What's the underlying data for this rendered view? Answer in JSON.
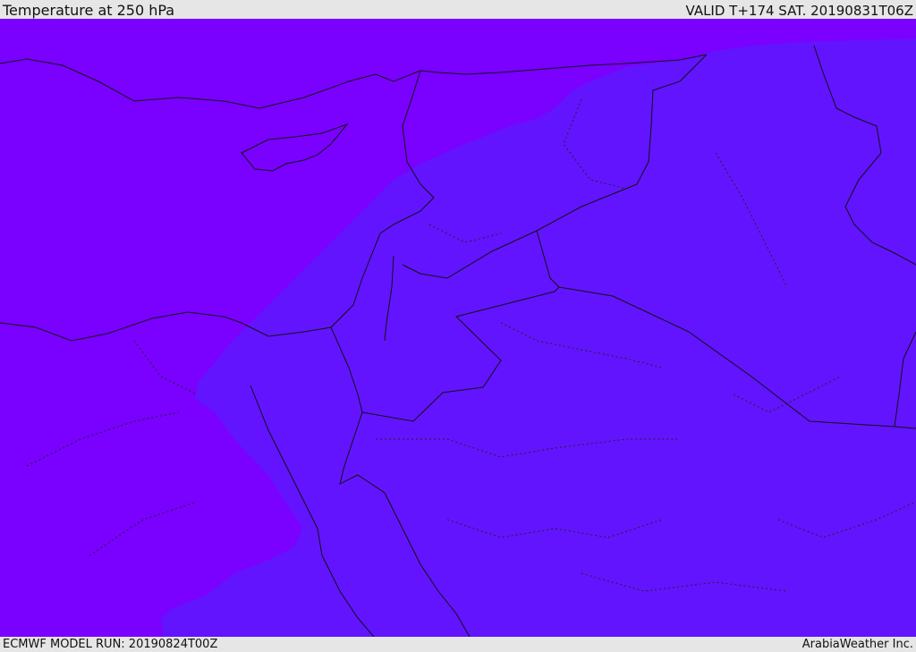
{
  "header": {
    "title": "Temperature at 250 hPa",
    "valid": "VALID T+174 SAT. 20190831T06Z"
  },
  "footer": {
    "model_run": "ECMWF MODEL RUN: 20190824T00Z",
    "credit": "ArabiaWeather Inc."
  },
  "colors": {
    "cold_fill": "#7a00ff",
    "warm_fill": "#6214ff",
    "border_line": "#111111",
    "bar_background": "#e6e6e6"
  }
}
